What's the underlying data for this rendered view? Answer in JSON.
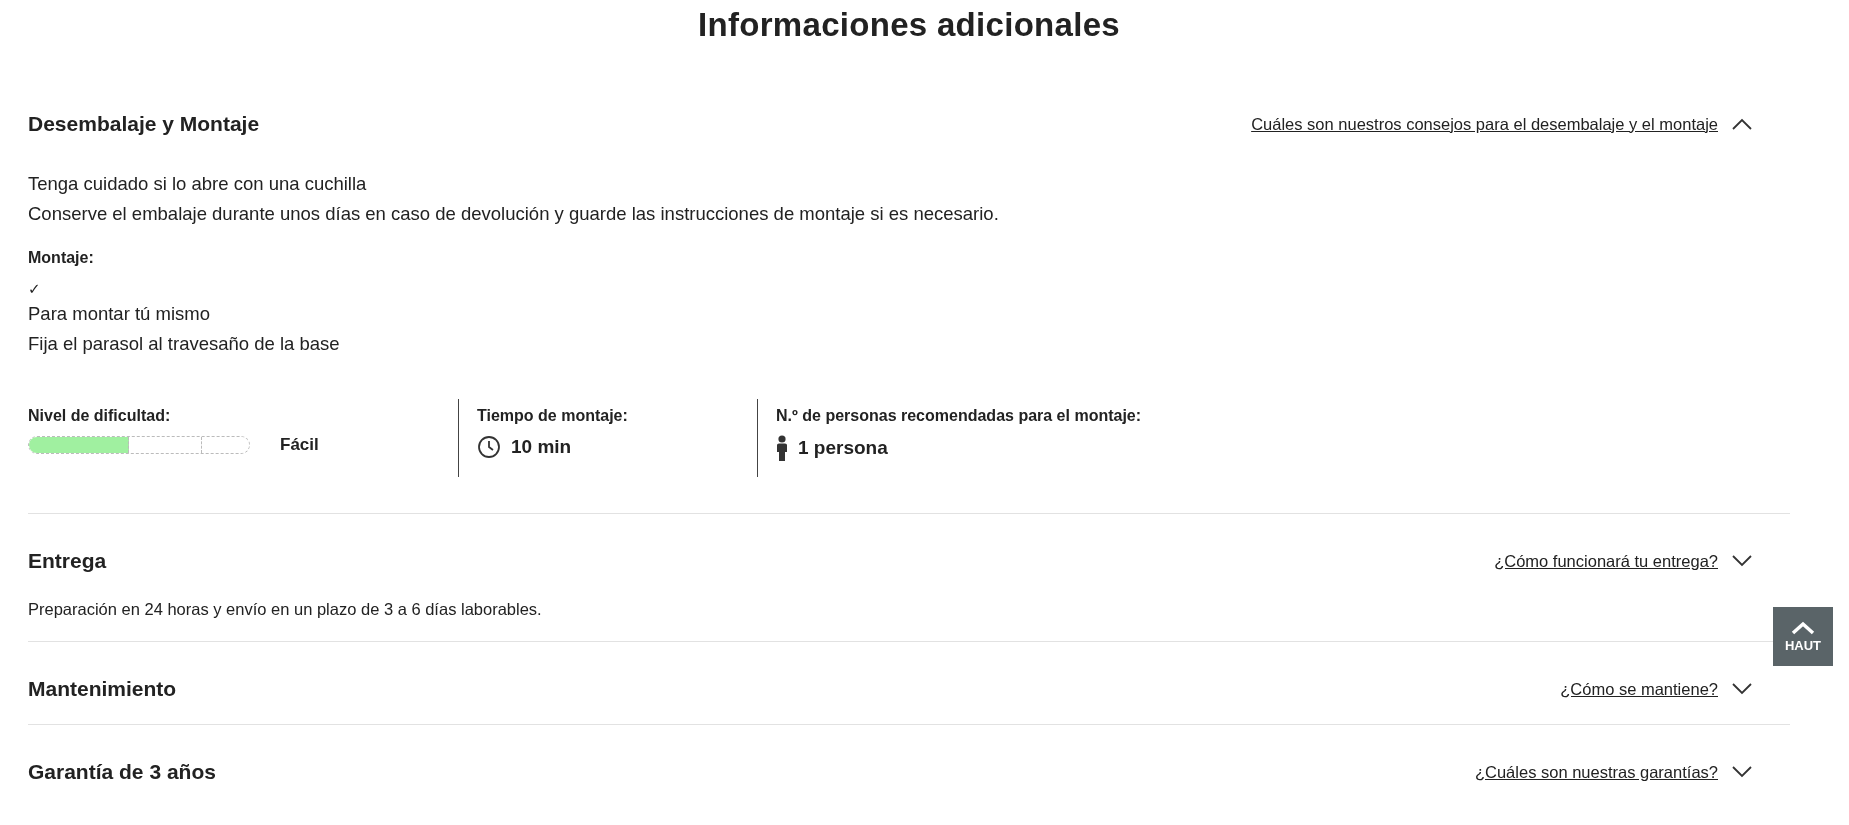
{
  "title": "Informaciones adicionales",
  "sections": [
    {
      "heading": "Desembalaje y Montaje",
      "link": "Cuáles son nuestros consejos para el desembalaje y el montaje",
      "expanded": true,
      "paragraphs": [
        "Tenga cuidado si lo abre con una cuchilla",
        "Conserve el embalaje durante unos días en caso de devolución y guarde las instrucciones de montaje si es necesario."
      ],
      "assembly": {
        "label": "Montaje:",
        "check": "✓",
        "lines": [
          "Para montar tú mismo",
          "Fija el parasol al travesaño de la base"
        ]
      },
      "stats": [
        {
          "kind": "difficulty",
          "label": "Nivel de dificultad:",
          "level": 0.45,
          "value": "Fácil"
        },
        {
          "kind": "time",
          "label": "Tiempo de montaje:",
          "value": "10 min"
        },
        {
          "kind": "people",
          "label": "N.º de personas recomendadas para el montaje:",
          "value": "1 persona"
        }
      ]
    },
    {
      "heading": "Entrega",
      "link": "¿Cómo funcionará tu entrega?",
      "expanded": false,
      "summary": "Preparación en 24 horas y envío en un plazo de 3 a 6 días laborables."
    },
    {
      "heading": "Mantenimiento",
      "link": "¿Cómo se mantiene?",
      "expanded": false
    },
    {
      "heading": "Garantía de 3 años",
      "link": "¿Cuáles son nuestras garantías?",
      "expanded": false
    }
  ],
  "back_to_top": "HAUT"
}
